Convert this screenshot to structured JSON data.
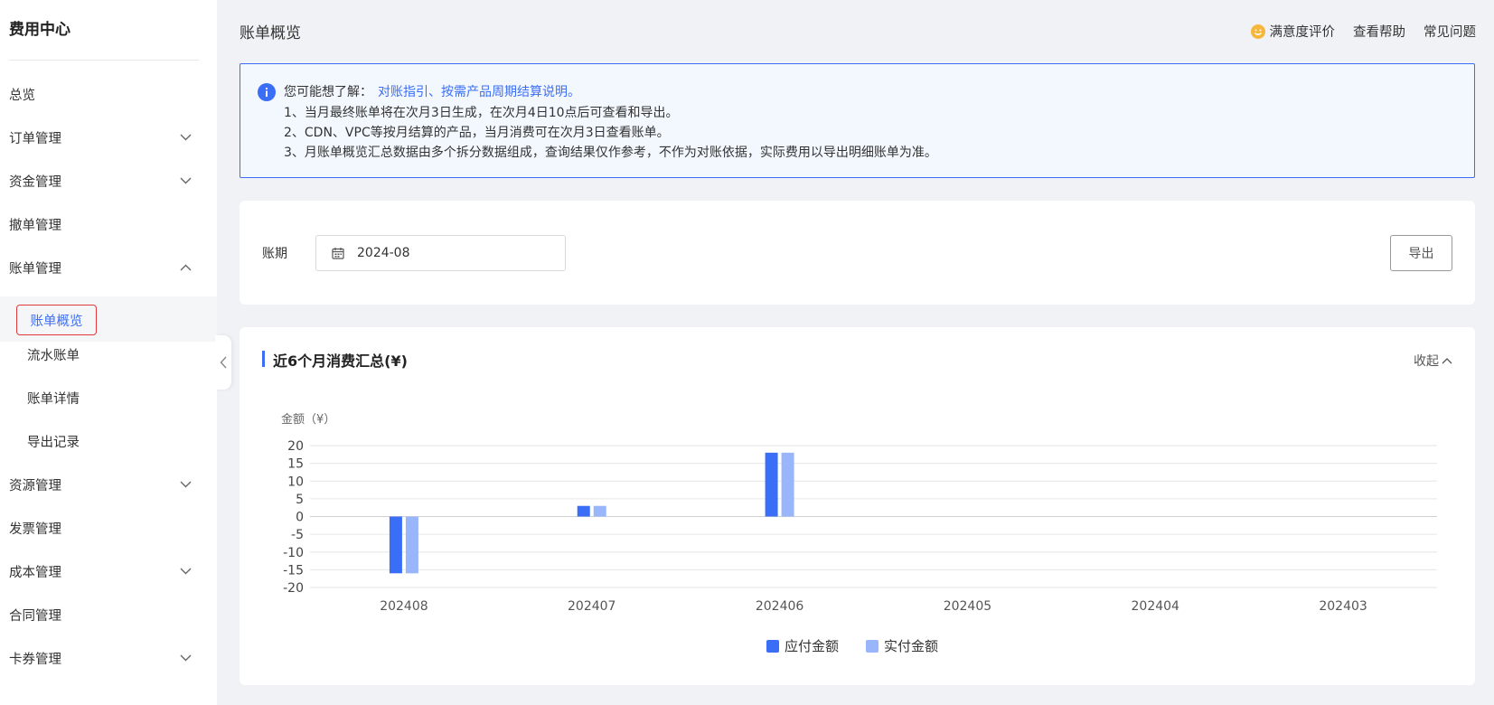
{
  "sidebar": {
    "title": "费用中心",
    "items": [
      {
        "label": "总览",
        "chevron": "none"
      },
      {
        "label": "订单管理",
        "chevron": "down"
      },
      {
        "label": "资金管理",
        "chevron": "down"
      },
      {
        "label": "撤单管理",
        "chevron": "none"
      },
      {
        "label": "账单管理",
        "chevron": "up"
      }
    ],
    "active_sub": "账单概览",
    "subitems": [
      "流水账单",
      "账单详情",
      "导出记录"
    ],
    "items_after": [
      {
        "label": "资源管理",
        "chevron": "down"
      },
      {
        "label": "发票管理",
        "chevron": "none"
      },
      {
        "label": "成本管理",
        "chevron": "down"
      },
      {
        "label": "合同管理",
        "chevron": "none"
      },
      {
        "label": "卡券管理",
        "chevron": "down"
      }
    ]
  },
  "header": {
    "title": "账单概览",
    "links": {
      "satisfaction": "满意度评价",
      "help": "查看帮助",
      "faq": "常见问题"
    }
  },
  "notice": {
    "lead": "您可能想了解：",
    "link": "对账指引、按需产品周期结算说明。",
    "lines": [
      "1、当月最终账单将在次月3日生成，在次月4日10点后可查看和导出。",
      "2、CDN、VPC等按月结算的产品，当月消费可在次月3日查看账单。",
      "3、月账单概览汇总数据由多个拆分数据组成，查询结果仅作参考，不作为对账依据，实际费用以导出明细账单为准。"
    ]
  },
  "filter": {
    "label": "账期",
    "period": "2024-08",
    "export_label": "导出"
  },
  "chart_section": {
    "title": "近6个月消费汇总(¥)",
    "collapse_label": "收起"
  },
  "colors": {
    "accent": "#3b6ef6",
    "series_paid": "#9ab6fb",
    "active_border": "#e4393c"
  },
  "chart_data": {
    "type": "bar",
    "ylabel": "金额（¥）",
    "ylim": [
      -20,
      20
    ],
    "yticks": [
      20,
      15,
      10,
      5,
      0,
      -5,
      -10,
      -15,
      -20
    ],
    "categories": [
      "202408",
      "202407",
      "202406",
      "202405",
      "202404",
      "202403"
    ],
    "series": [
      {
        "name": "应付金额",
        "values": [
          -16,
          3,
          18,
          0,
          0,
          0
        ],
        "color": "#3b6ef6"
      },
      {
        "name": "实付金额",
        "values": [
          -16,
          3,
          18,
          0,
          0,
          0
        ],
        "color": "#9ab6fb"
      }
    ],
    "legend": "bottom-center",
    "grid": true
  }
}
